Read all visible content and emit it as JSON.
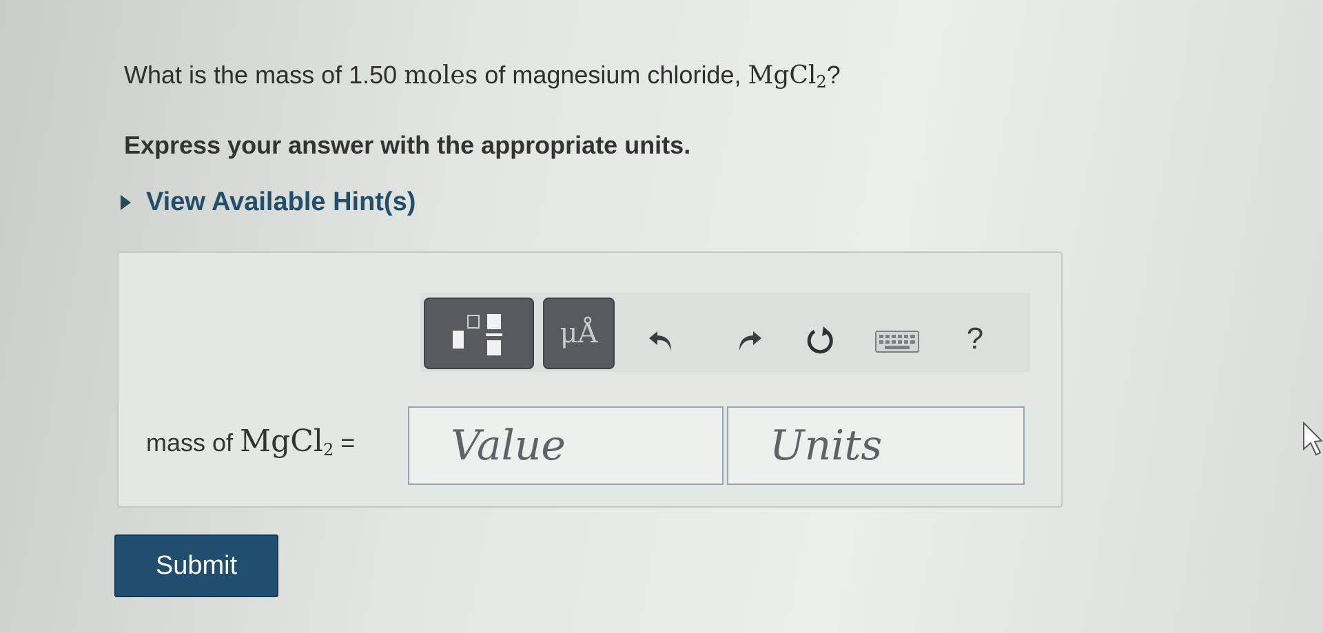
{
  "question": {
    "text_before": "What is the mass of 1.50 ",
    "moles_word": "moles",
    "text_middle": " of magnesium chloride, ",
    "formula_main": "MgCl",
    "formula_sub": "2",
    "text_after": "?"
  },
  "instruction": "Express your answer with the appropriate units.",
  "hint": {
    "label": "View Available Hint(s)",
    "icon": "caret-right-icon"
  },
  "toolbar": {
    "templates_icon": "templates-icon",
    "units_label": "μÅ",
    "undo_icon": "undo-icon",
    "redo_icon": "redo-icon",
    "reset_icon": "reset-icon",
    "keyboard_icon": "keyboard-icon",
    "help_label": "?"
  },
  "answer": {
    "label_text": "mass of ",
    "formula_main": "MgCl",
    "formula_sub": "2",
    "equals": " =",
    "value_placeholder": "Value",
    "value": "",
    "units_placeholder": "Units",
    "units": ""
  },
  "submit_label": "Submit",
  "colors": {
    "link": "#214e6a",
    "submit_bg": "#1f4e6e",
    "toolbar_dark": "#575a5e",
    "field_border": "#8ea8b6"
  }
}
